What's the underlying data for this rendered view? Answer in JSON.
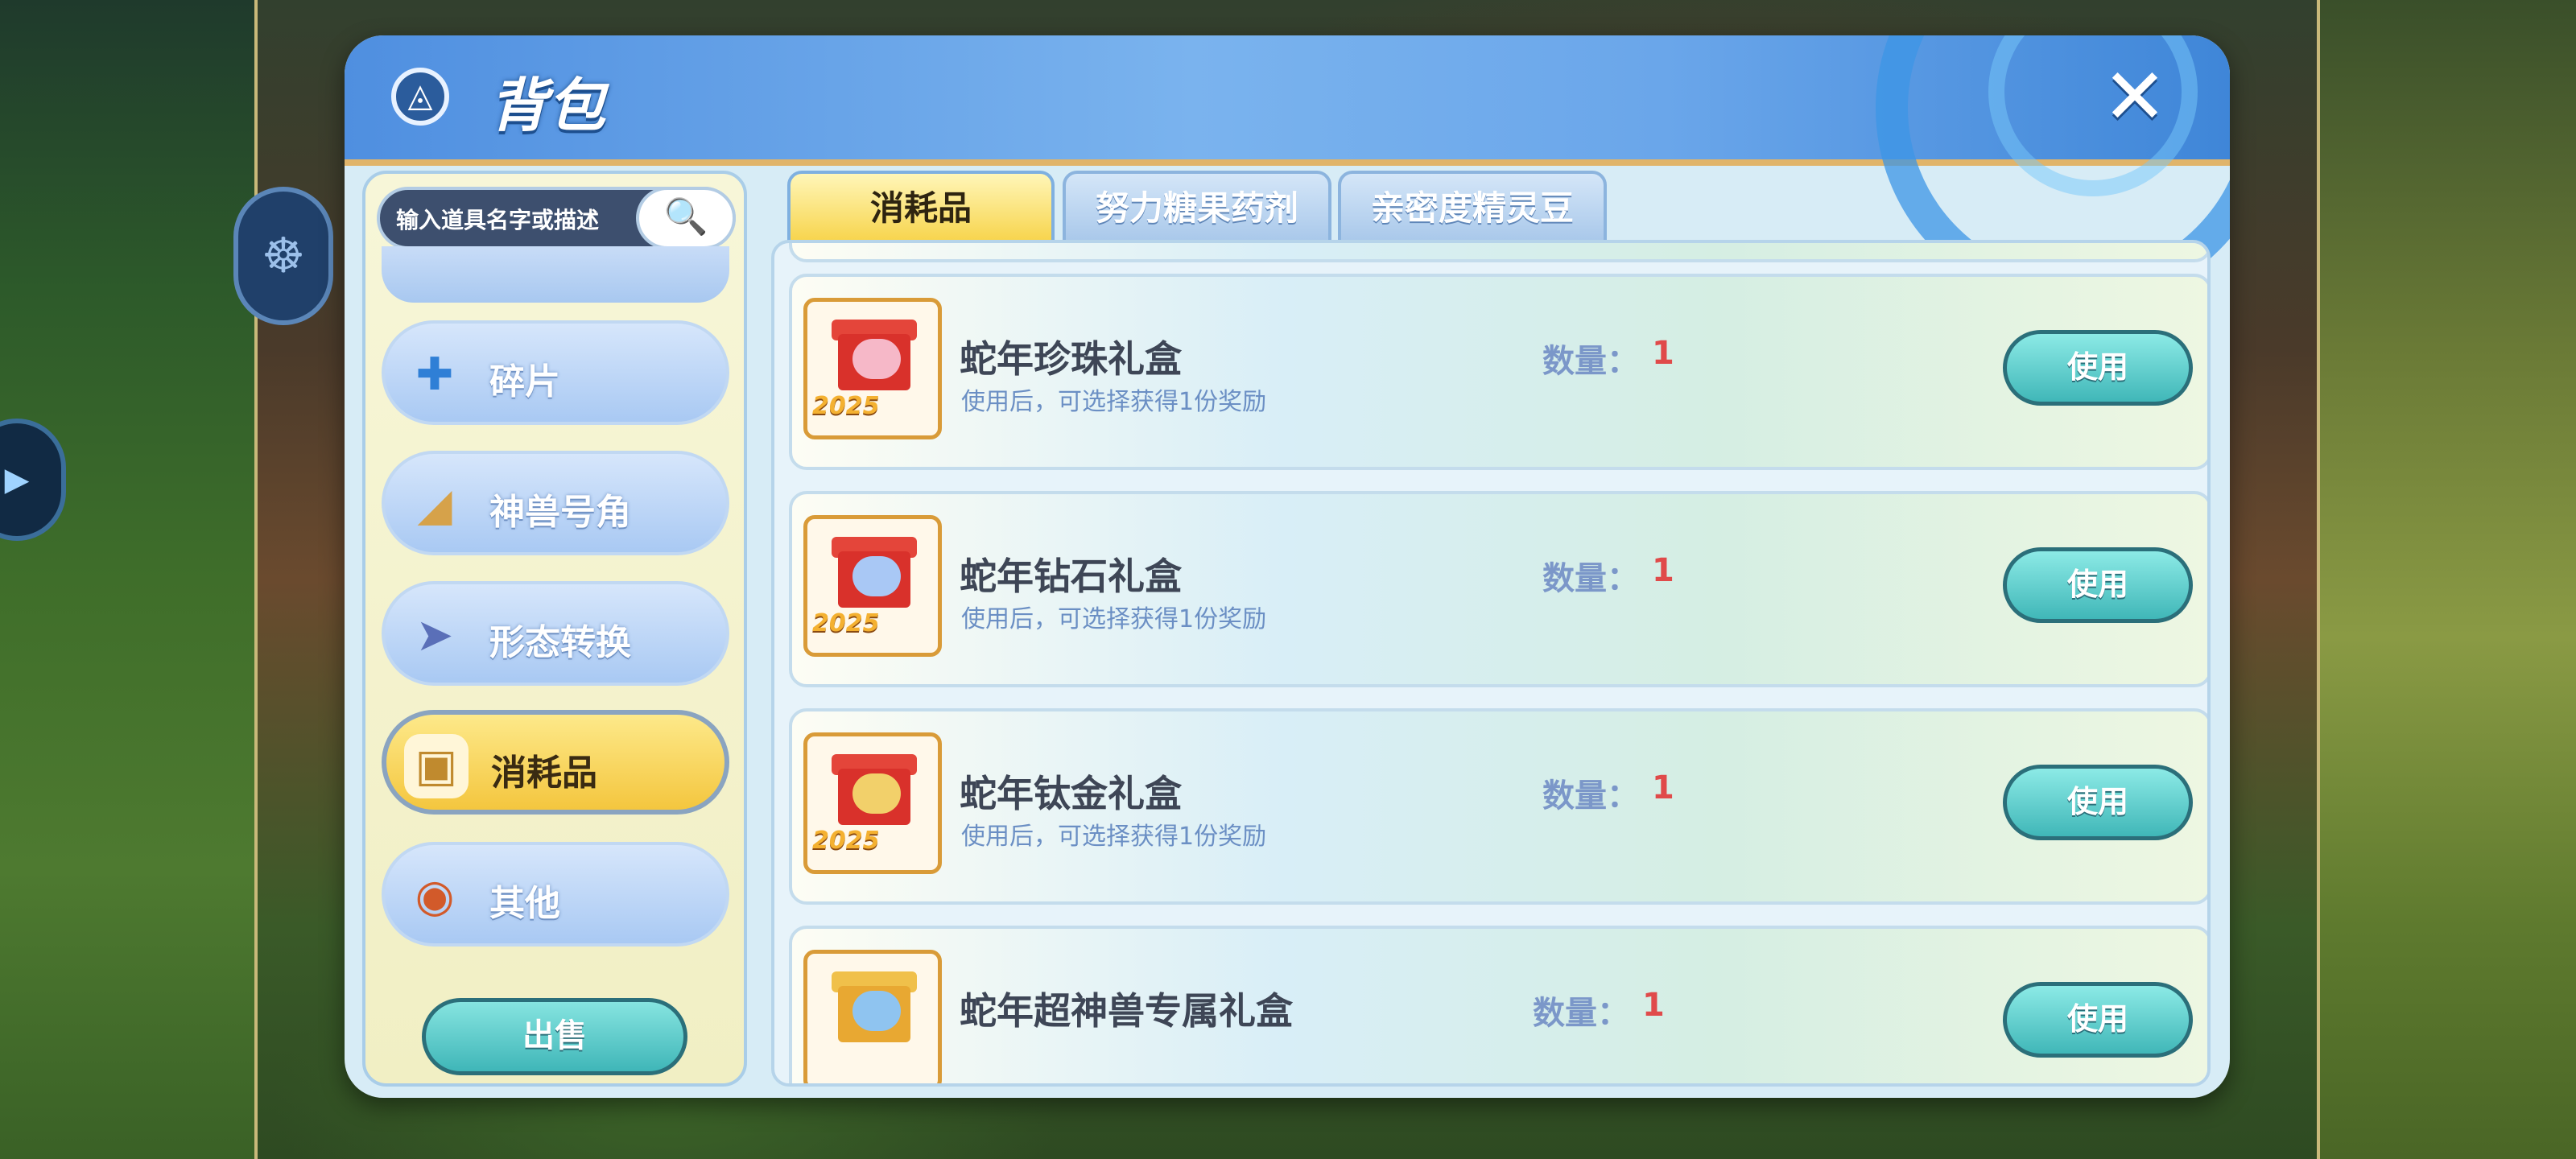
{
  "window": {
    "title": "背包",
    "close_label": "✕"
  },
  "search": {
    "placeholder": "输入道具名字或描述"
  },
  "sidebar": {
    "items": [
      {
        "label": "碎片",
        "icon": "puzzle-icon"
      },
      {
        "label": "神兽号角",
        "icon": "horn-icon"
      },
      {
        "label": "形态转换",
        "icon": "transform-icon"
      },
      {
        "label": "消耗品",
        "icon": "box-icon",
        "active": true
      },
      {
        "label": "其他",
        "icon": "megaphone-icon"
      }
    ],
    "sell_label": "出售"
  },
  "tabs": [
    {
      "label": "消耗品",
      "active": true
    },
    {
      "label": "努力糖果药剂",
      "active": false
    },
    {
      "label": "亲密度精灵豆",
      "active": false
    }
  ],
  "items": [
    {
      "name": "蛇年珍珠礼盒",
      "desc": "使用后，可选择获得1份奖励",
      "qty_label": "数量：",
      "qty": "1",
      "use_label": "使用",
      "year": "2025"
    },
    {
      "name": "蛇年钻石礼盒",
      "desc": "使用后，可选择获得1份奖励",
      "qty_label": "数量：",
      "qty": "1",
      "use_label": "使用",
      "year": "2025"
    },
    {
      "name": "蛇年钛金礼盒",
      "desc": "使用后，可选择获得1份奖励",
      "qty_label": "数量：",
      "qty": "1",
      "use_label": "使用",
      "year": "2025"
    },
    {
      "name": "蛇年超神兽专属礼盒",
      "desc": "",
      "qty_label": "数量：",
      "qty": "1",
      "use_label": "使用",
      "year": ""
    }
  ],
  "colors": {
    "accent": "#f4c63e",
    "qty": "#e04a4a",
    "button": "#40b7b8"
  }
}
